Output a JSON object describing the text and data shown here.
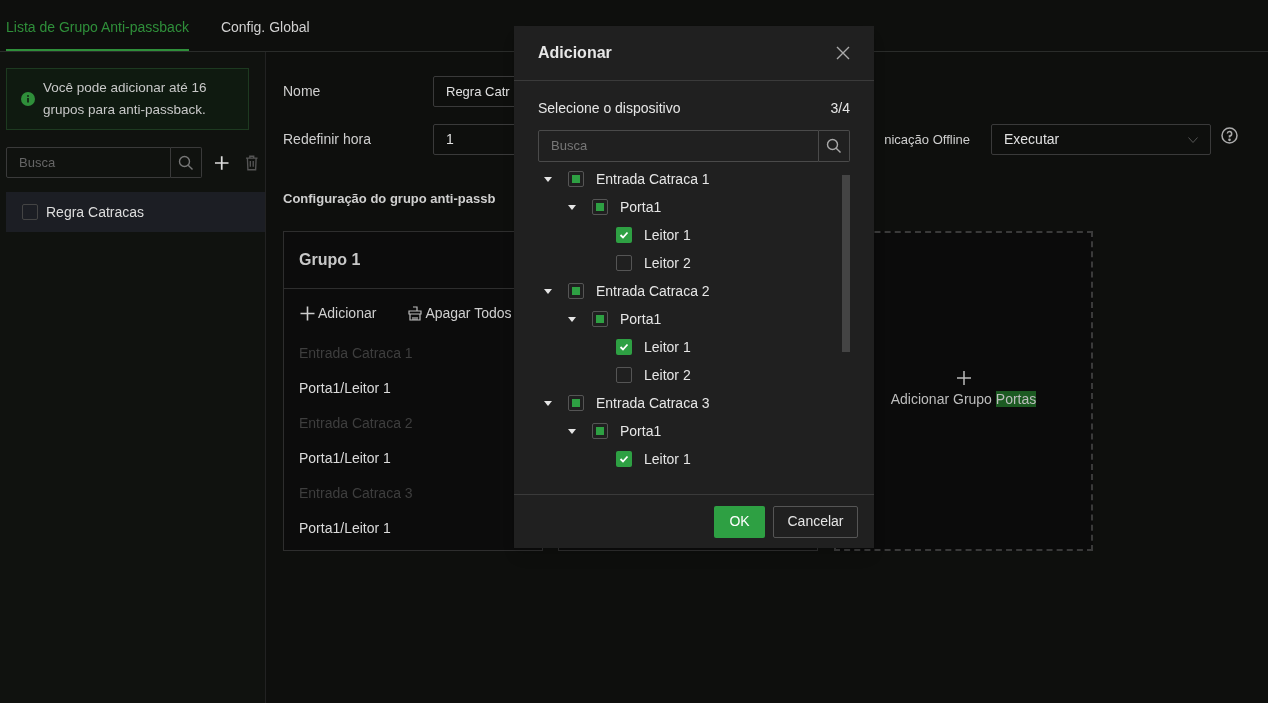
{
  "tabs": [
    {
      "label": "Lista de Grupo Anti-passback",
      "selected": true
    },
    {
      "label": "Config. Global",
      "selected": false
    }
  ],
  "sidebar": {
    "notice": "Você pode adicionar até 16 grupos para anti-passback.",
    "search": {
      "placeholder": "Busca"
    },
    "items": [
      {
        "label": "Regra Catracas",
        "checked": false,
        "selected": true
      }
    ]
  },
  "form": {
    "name_label": "Nome",
    "name_value": "Regra Catr",
    "reset_label": "Redefinir hora",
    "reset_value": "1",
    "offline_label": "nicação Offline",
    "offline_value": "Executar",
    "section_title": "Configuração do grupo anti-passb"
  },
  "group_card": {
    "title": "Grupo 1",
    "add": "Adicionar",
    "delete_all": "Apagar Todos",
    "entries": [
      {
        "device": "Entrada Catraca 1",
        "reader": "Porta1/Leitor 1"
      },
      {
        "device": "Entrada Catraca 2",
        "reader": "Porta1/Leitor 1"
      },
      {
        "device": "Entrada Catraca 3",
        "reader": "Porta1/Leitor 1"
      }
    ]
  },
  "add_group": {
    "label": "Adicionar Grupo",
    "highlight": "Portas"
  },
  "dialog": {
    "title": "Adicionar",
    "subtitle": "Selecione o dispositivo",
    "count": "3/4",
    "search": {
      "placeholder": "Busca"
    },
    "tree": [
      {
        "label": "Entrada Catraca 1",
        "expanded": true,
        "checked": false,
        "indeterminate": true,
        "children": [
          {
            "label": "Porta1",
            "expanded": true,
            "checked": false,
            "indeterminate": true,
            "children": [
              {
                "label": "Leitor 1",
                "checked": true
              },
              {
                "label": "Leitor 2",
                "checked": false
              }
            ]
          }
        ]
      },
      {
        "label": "Entrada Catraca 2",
        "expanded": true,
        "checked": false,
        "indeterminate": true,
        "children": [
          {
            "label": "Porta1",
            "expanded": true,
            "checked": false,
            "indeterminate": true,
            "children": [
              {
                "label": "Leitor 1",
                "checked": true
              },
              {
                "label": "Leitor 2",
                "checked": false
              }
            ]
          }
        ]
      },
      {
        "label": "Entrada Catraca 3",
        "expanded": true,
        "checked": false,
        "indeterminate": true,
        "children": [
          {
            "label": "Porta1",
            "expanded": true,
            "checked": false,
            "indeterminate": true,
            "children": [
              {
                "label": "Leitor 1",
                "checked": true
              }
            ]
          }
        ]
      }
    ],
    "ok": "OK",
    "cancel": "Cancelar"
  }
}
